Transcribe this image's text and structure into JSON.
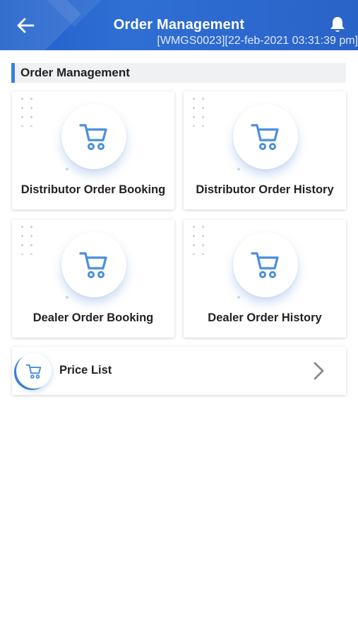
{
  "header": {
    "title": "Order Management",
    "subtitle": "[WMGS0023][22-feb-2021 03:31:39 pm]",
    "back_icon": "arrow-left-icon",
    "bell_icon": "bell-icon"
  },
  "section": {
    "title": "Order Management"
  },
  "tiles": [
    {
      "label": "Distributor Order Booking",
      "icon": "cart-icon"
    },
    {
      "label": "Distributor Order History",
      "icon": "cart-icon"
    },
    {
      "label": "Dealer Order Booking",
      "icon": "cart-icon"
    },
    {
      "label": "Dealer Order History",
      "icon": "cart-icon"
    }
  ],
  "price_list": {
    "label": "Price List",
    "icon": "cart-icon",
    "chevron_icon": "chevron-right-icon"
  },
  "colors": {
    "primary": "#2a63c8",
    "accent": "#3b7ed8",
    "icon": "#4a8ee0"
  }
}
